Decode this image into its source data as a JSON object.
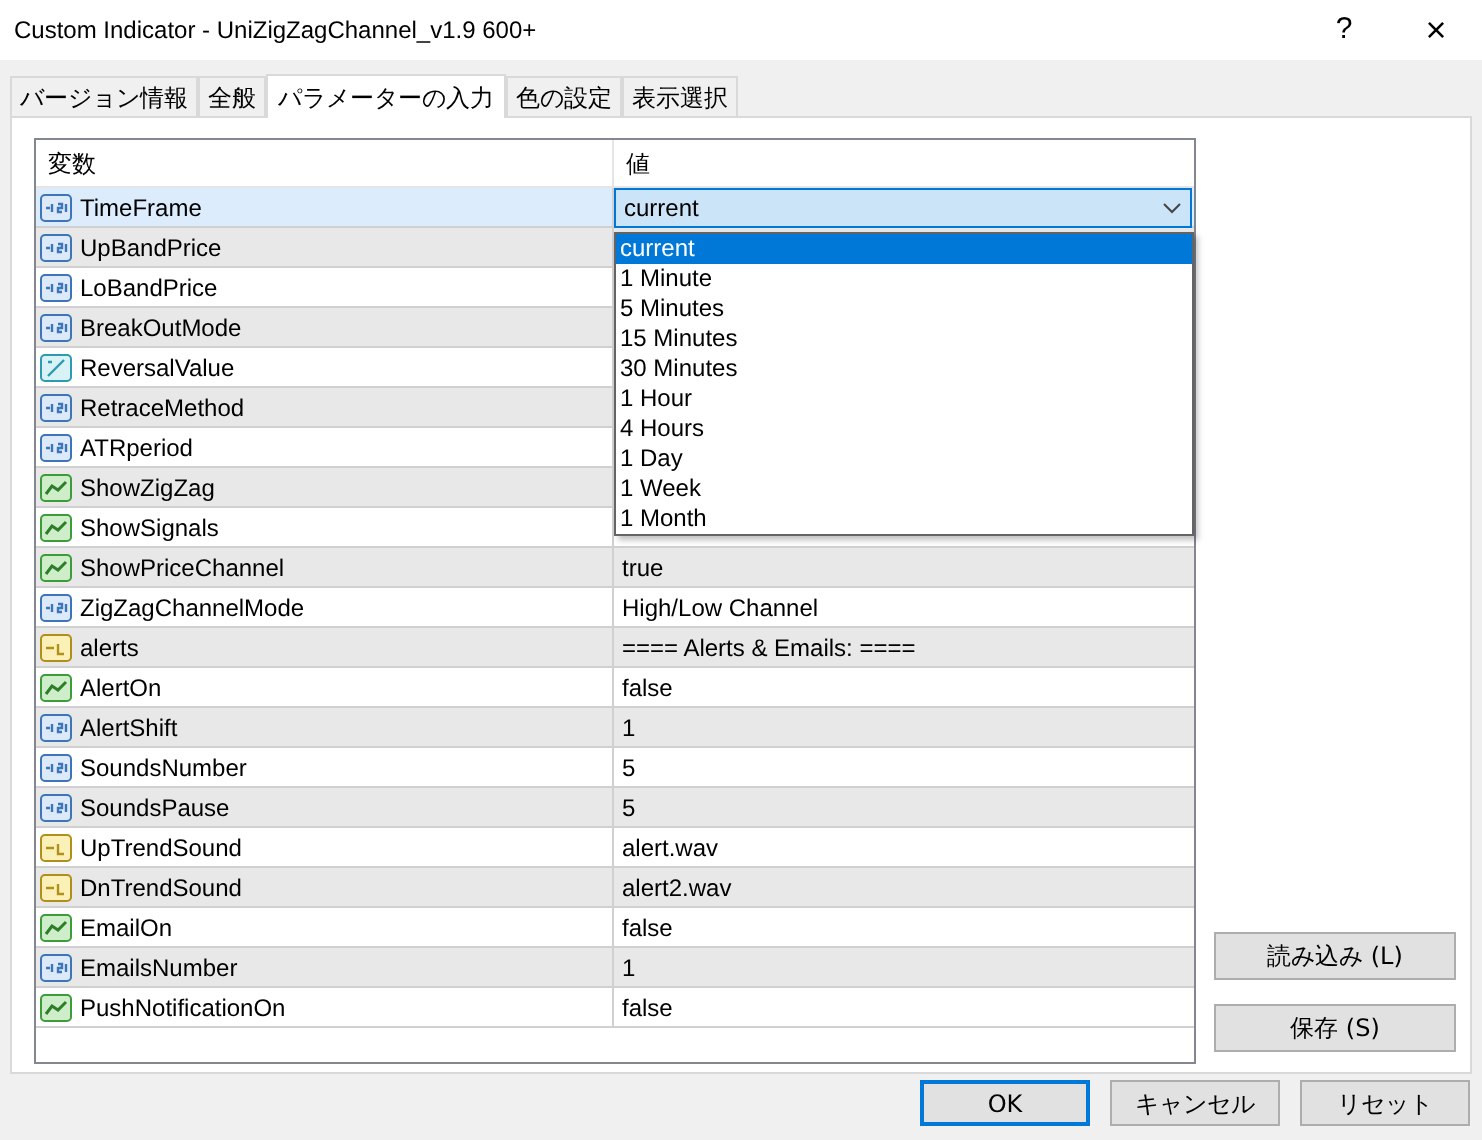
{
  "window": {
    "title": "Custom Indicator - UniZigZagChannel_v1.9 600+",
    "help": "?",
    "close": "×"
  },
  "tabs": [
    {
      "label": "バージョン情報",
      "selected": false
    },
    {
      "label": "全般",
      "selected": false
    },
    {
      "label": "パラメーターの入力",
      "selected": true
    },
    {
      "label": "色の設定",
      "selected": false
    },
    {
      "label": "表示選択",
      "selected": false
    }
  ],
  "table": {
    "columns": [
      "変数",
      "値"
    ],
    "rows": [
      {
        "kind": "int",
        "name": "TimeFrame",
        "value": "current",
        "selected": true
      },
      {
        "kind": "int",
        "name": "UpBandPrice",
        "selected": false
      },
      {
        "kind": "int",
        "name": "LoBandPrice",
        "selected": false
      },
      {
        "kind": "int",
        "name": "BreakOutMode",
        "selected": false
      },
      {
        "kind": "double",
        "name": "ReversalValue",
        "selected": false
      },
      {
        "kind": "int",
        "name": "RetraceMethod",
        "selected": false
      },
      {
        "kind": "int",
        "name": "ATRperiod",
        "selected": false
      },
      {
        "kind": "bool",
        "name": "ShowZigZag",
        "selected": false
      },
      {
        "kind": "bool",
        "name": "ShowSignals",
        "selected": false
      },
      {
        "kind": "bool",
        "name": "ShowPriceChannel",
        "value": "true",
        "selected": false
      },
      {
        "kind": "int",
        "name": "ZigZagChannelMode",
        "value": "High/Low Channel",
        "selected": false
      },
      {
        "kind": "string",
        "name": "alerts",
        "value": "==== Alerts & Emails: ====",
        "selected": false
      },
      {
        "kind": "bool",
        "name": "AlertOn",
        "value": "false",
        "selected": false
      },
      {
        "kind": "int",
        "name": "AlertShift",
        "value": "1",
        "selected": false
      },
      {
        "kind": "int",
        "name": "SoundsNumber",
        "value": "5",
        "selected": false
      },
      {
        "kind": "int",
        "name": "SoundsPause",
        "value": "5",
        "selected": false
      },
      {
        "kind": "string",
        "name": "UpTrendSound",
        "value": "alert.wav",
        "selected": false
      },
      {
        "kind": "string",
        "name": "DnTrendSound",
        "value": "alert2.wav",
        "selected": false
      },
      {
        "kind": "bool",
        "name": "EmailOn",
        "value": "false",
        "selected": false
      },
      {
        "kind": "int",
        "name": "EmailsNumber",
        "value": "1",
        "selected": false
      },
      {
        "kind": "bool",
        "name": "PushNotificationOn",
        "value": "false",
        "selected": false
      }
    ]
  },
  "dropdown": {
    "options": [
      {
        "label": "current",
        "selected": true
      },
      {
        "label": "1 Minute",
        "selected": false
      },
      {
        "label": "5 Minutes",
        "selected": false
      },
      {
        "label": "15 Minutes",
        "selected": false
      },
      {
        "label": "30 Minutes",
        "selected": false
      },
      {
        "label": "1 Hour",
        "selected": false
      },
      {
        "label": "4 Hours",
        "selected": false
      },
      {
        "label": "1 Day",
        "selected": false
      },
      {
        "label": "1 Week",
        "selected": false
      },
      {
        "label": "1 Month",
        "selected": false
      }
    ]
  },
  "side_buttons": [
    "読み込み (L)",
    "保存 (S)"
  ],
  "buttons": [
    {
      "label": "OK",
      "default": true
    },
    {
      "label": "キャンセル",
      "default": false
    },
    {
      "label": "リセット",
      "default": false
    }
  ]
}
